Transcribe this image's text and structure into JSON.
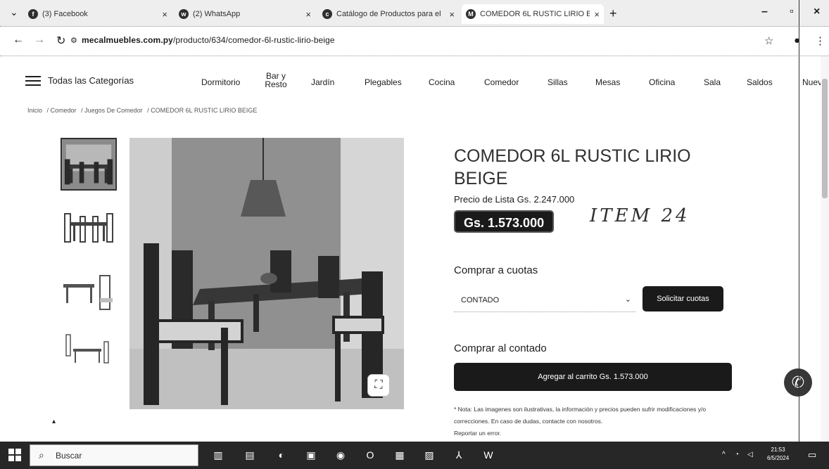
{
  "browser": {
    "tabs": [
      {
        "icon": "f",
        "title": "(3) Facebook"
      },
      {
        "icon": "w",
        "title": "(2) WhatsApp"
      },
      {
        "icon": "c",
        "title": "Catálogo de Productos para el"
      },
      {
        "icon": "M",
        "title": "COMEDOR 6L RUSTIC LIRIO BEI"
      }
    ],
    "url_domain": "mecalmuebles.com.py",
    "url_path": "/producto/634/comedor-6l-rustic-lirio-beige"
  },
  "nav": {
    "all_categories": "Todas las Categorías",
    "items": [
      "Dormitorio",
      "Bar y Resto",
      "Jardín",
      "Plegables",
      "Cocina",
      "Comedor",
      "Sillas",
      "Mesas",
      "Oficina",
      "Sala",
      "Saldos",
      "Nuev"
    ]
  },
  "breadcrumb": [
    "Inicio",
    "/ Comedor",
    "/ Juegos De Comedor",
    "/ COMEDOR 6L RUSTIC LIRIO BEIGE"
  ],
  "product": {
    "title": "COMEDOR 6L RUSTIC LIRIO BEIGE",
    "list_price": "Precio de Lista Gs. 2.247.000",
    "price": "Gs. 1.573.000",
    "handwritten_note": "ITEM 24",
    "cuotas_heading": "Comprar a cuotas",
    "cuotas_select": "CONTADO",
    "cuotas_button": "Solicitar cuotas",
    "contado_heading": "Comprar al contado",
    "cart_button": "Agregar al carrito Gs. 1.573.000",
    "note": "* Nota: Las imagenes son ilustrativas, la información y precios pueden sufrir modificaciones y/o correcciones. En caso de dudas, contacte con nosotros.",
    "report": "Reportar un error."
  },
  "taskbar": {
    "search_placeholder": "Buscar",
    "time": "21:53",
    "date": "6/5/2024"
  }
}
